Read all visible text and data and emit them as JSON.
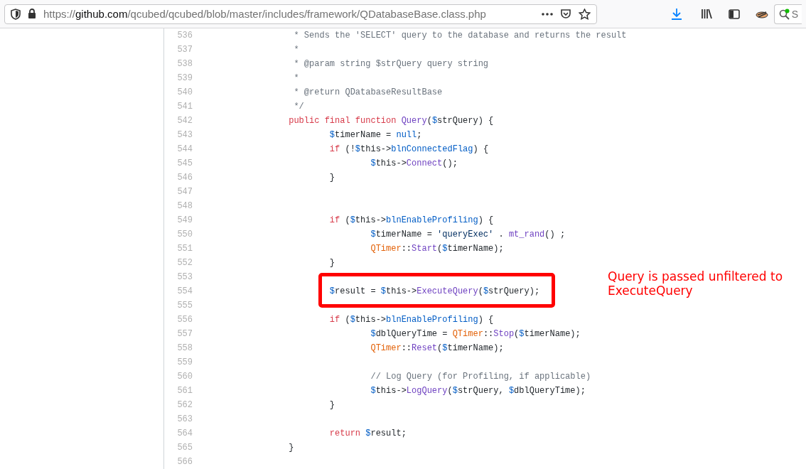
{
  "address_bar": {
    "scheme": "https://",
    "host": "github.com",
    "path": "/qcubed/qcubed/blob/master/includes/framework/QDatabaseBase.class.php"
  },
  "search": {
    "placeholder": "S"
  },
  "code": {
    "lines": [
      {
        "number": "536",
        "boxed": false,
        "tokens": [
          {
            "kind": "comment",
            "t": "\t\t * Sends the 'SELECT' query to the database and returns the result"
          }
        ]
      },
      {
        "number": "537",
        "boxed": false,
        "tokens": [
          {
            "kind": "comment",
            "t": "\t\t *"
          }
        ]
      },
      {
        "number": "538",
        "boxed": false,
        "tokens": [
          {
            "kind": "comment",
            "t": "\t\t * @param string $strQuery query string"
          }
        ]
      },
      {
        "number": "539",
        "boxed": false,
        "tokens": [
          {
            "kind": "comment",
            "t": "\t\t *"
          }
        ]
      },
      {
        "number": "540",
        "boxed": false,
        "tokens": [
          {
            "kind": "comment",
            "t": "\t\t * @return QDatabaseResultBase"
          }
        ]
      },
      {
        "number": "541",
        "boxed": false,
        "tokens": [
          {
            "kind": "comment",
            "t": "\t\t */"
          }
        ]
      },
      {
        "number": "542",
        "boxed": false,
        "tokens": [
          {
            "kind": "keyword",
            "t": "\t\tpublic final function "
          },
          {
            "kind": "func",
            "t": "Query"
          },
          {
            "kind": "plain",
            "t": "("
          },
          {
            "kind": "var",
            "t": "$"
          },
          {
            "kind": "plain",
            "t": "strQuery) {"
          }
        ]
      },
      {
        "number": "543",
        "boxed": false,
        "tokens": [
          {
            "kind": "var",
            "t": "\t\t\t$"
          },
          {
            "kind": "plain",
            "t": "timerName = "
          },
          {
            "kind": "prop",
            "t": "null"
          },
          {
            "kind": "plain",
            "t": ";"
          }
        ]
      },
      {
        "number": "544",
        "boxed": false,
        "tokens": [
          {
            "kind": "keyword",
            "t": "\t\t\tif"
          },
          {
            "kind": "plain",
            "t": " (!"
          },
          {
            "kind": "var",
            "t": "$"
          },
          {
            "kind": "plain",
            "t": "this->"
          },
          {
            "kind": "prop",
            "t": "blnConnectedFlag"
          },
          {
            "kind": "plain",
            "t": ") {"
          }
        ]
      },
      {
        "number": "545",
        "boxed": false,
        "tokens": [
          {
            "kind": "var",
            "t": "\t\t\t\t$"
          },
          {
            "kind": "plain",
            "t": "this->"
          },
          {
            "kind": "func",
            "t": "Connect"
          },
          {
            "kind": "plain",
            "t": "();"
          }
        ]
      },
      {
        "number": "546",
        "boxed": false,
        "tokens": [
          {
            "kind": "plain",
            "t": "\t\t\t}"
          }
        ]
      },
      {
        "number": "547",
        "boxed": false
      },
      {
        "number": "548",
        "boxed": false
      },
      {
        "number": "549",
        "boxed": false,
        "tokens": [
          {
            "kind": "keyword",
            "t": "\t\t\tif"
          },
          {
            "kind": "plain",
            "t": " ("
          },
          {
            "kind": "var",
            "t": "$"
          },
          {
            "kind": "plain",
            "t": "this->"
          },
          {
            "kind": "prop",
            "t": "blnEnableProfiling"
          },
          {
            "kind": "plain",
            "t": ") {"
          }
        ]
      },
      {
        "number": "550",
        "boxed": false,
        "tokens": [
          {
            "kind": "var",
            "t": "\t\t\t\t$"
          },
          {
            "kind": "plain",
            "t": "timerName = "
          },
          {
            "kind": "string",
            "t": "'queryExec'"
          },
          {
            "kind": "plain",
            "t": " . "
          },
          {
            "kind": "func",
            "t": "mt_rand"
          },
          {
            "kind": "plain",
            "t": "() ;"
          }
        ]
      },
      {
        "number": "551",
        "boxed": false,
        "tokens": [
          {
            "kind": "class",
            "t": "\t\t\t\tQTimer"
          },
          {
            "kind": "plain",
            "t": "::"
          },
          {
            "kind": "func",
            "t": "Start"
          },
          {
            "kind": "plain",
            "t": "("
          },
          {
            "kind": "var",
            "t": "$"
          },
          {
            "kind": "plain",
            "t": "timerName);"
          }
        ]
      },
      {
        "number": "552",
        "boxed": false,
        "tokens": [
          {
            "kind": "plain",
            "t": "\t\t\t}"
          }
        ]
      },
      {
        "number": "553",
        "boxed": false
      },
      {
        "number": "554",
        "boxed": true,
        "tokens": [
          {
            "kind": "var",
            "t": "\t\t\t$"
          },
          {
            "kind": "plain",
            "t": "result = "
          },
          {
            "kind": "var",
            "t": "$"
          },
          {
            "kind": "plain",
            "t": "this->"
          },
          {
            "kind": "func",
            "t": "ExecuteQuery"
          },
          {
            "kind": "plain",
            "t": "("
          },
          {
            "kind": "var",
            "t": "$"
          },
          {
            "kind": "plain",
            "t": "strQuery);"
          }
        ]
      },
      {
        "number": "555",
        "boxed": false
      },
      {
        "number": "556",
        "boxed": false,
        "tokens": [
          {
            "kind": "keyword",
            "t": "\t\t\tif"
          },
          {
            "kind": "plain",
            "t": " ("
          },
          {
            "kind": "var",
            "t": "$"
          },
          {
            "kind": "plain",
            "t": "this->"
          },
          {
            "kind": "prop",
            "t": "blnEnableProfiling"
          },
          {
            "kind": "plain",
            "t": ") {"
          }
        ]
      },
      {
        "number": "557",
        "boxed": false,
        "tokens": [
          {
            "kind": "var",
            "t": "\t\t\t\t$"
          },
          {
            "kind": "plain",
            "t": "dblQueryTime = "
          },
          {
            "kind": "class",
            "t": "QTimer"
          },
          {
            "kind": "plain",
            "t": "::"
          },
          {
            "kind": "func",
            "t": "Stop"
          },
          {
            "kind": "plain",
            "t": "("
          },
          {
            "kind": "var",
            "t": "$"
          },
          {
            "kind": "plain",
            "t": "timerName);"
          }
        ]
      },
      {
        "number": "558",
        "boxed": false,
        "tokens": [
          {
            "kind": "class",
            "t": "\t\t\t\tQTimer"
          },
          {
            "kind": "plain",
            "t": "::"
          },
          {
            "kind": "func",
            "t": "Reset"
          },
          {
            "kind": "plain",
            "t": "("
          },
          {
            "kind": "var",
            "t": "$"
          },
          {
            "kind": "plain",
            "t": "timerName);"
          }
        ]
      },
      {
        "number": "559",
        "boxed": false
      },
      {
        "number": "560",
        "boxed": false,
        "tokens": [
          {
            "kind": "comment",
            "t": "\t\t\t\t// Log Query (for Profiling, if applicable)"
          }
        ]
      },
      {
        "number": "561",
        "boxed": false,
        "tokens": [
          {
            "kind": "var",
            "t": "\t\t\t\t$"
          },
          {
            "kind": "plain",
            "t": "this->"
          },
          {
            "kind": "func",
            "t": "LogQuery"
          },
          {
            "kind": "plain",
            "t": "("
          },
          {
            "kind": "var",
            "t": "$"
          },
          {
            "kind": "plain",
            "t": "strQuery, "
          },
          {
            "kind": "var",
            "t": "$"
          },
          {
            "kind": "plain",
            "t": "dblQueryTime);"
          }
        ]
      },
      {
        "number": "562",
        "boxed": false,
        "tokens": [
          {
            "kind": "plain",
            "t": "\t\t\t}"
          }
        ]
      },
      {
        "number": "563",
        "boxed": false
      },
      {
        "number": "564",
        "boxed": false,
        "tokens": [
          {
            "kind": "keyword",
            "t": "\t\t\treturn "
          },
          {
            "kind": "var",
            "t": "$"
          },
          {
            "kind": "plain",
            "t": "result;"
          }
        ]
      },
      {
        "number": "565",
        "boxed": false,
        "tokens": [
          {
            "kind": "plain",
            "t": "\t\t}"
          }
        ]
      },
      {
        "number": "566",
        "boxed": false
      }
    ]
  },
  "annotation": {
    "text": "Query is passed unfiltered to ExecuteQuery"
  }
}
